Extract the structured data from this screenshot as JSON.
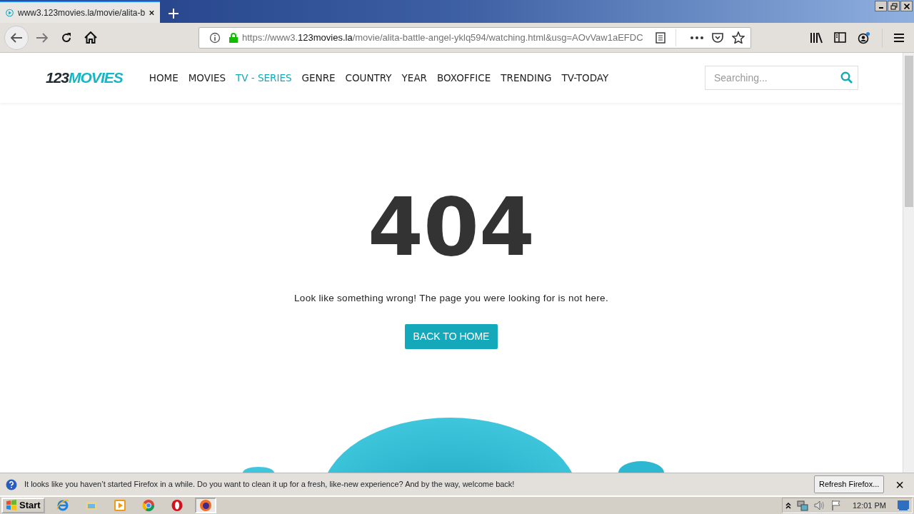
{
  "browser": {
    "tabs": [
      {
        "title": "www3.123movies.la/movie/alita-b",
        "selected": true
      }
    ],
    "url": {
      "scheme": "https://www3.",
      "domain": "123movies.la",
      "path": "/movie/alita-battle-angel-yklq594/watching.html&usg=AOvVaw1aEFDC"
    }
  },
  "site": {
    "logo": {
      "digits": "123",
      "word": "MOVIES"
    },
    "nav": [
      {
        "label": "HOME",
        "selected": false
      },
      {
        "label": "MOVIES",
        "selected": false
      },
      {
        "label": "TV - SERIES",
        "selected": true
      },
      {
        "label": "GENRE",
        "selected": false
      },
      {
        "label": "COUNTRY",
        "selected": false
      },
      {
        "label": "YEAR",
        "selected": false
      },
      {
        "label": "BOXOFFICE",
        "selected": false
      },
      {
        "label": "TRENDING",
        "selected": false
      },
      {
        "label": "TV-TODAY",
        "selected": false
      }
    ],
    "search": {
      "placeholder": "Searching..."
    },
    "error": {
      "code": "404",
      "message": "Look like something wrong! The page you were looking for is not here.",
      "button": "BACK TO HOME"
    }
  },
  "notification": {
    "text": "It looks like you haven’t started Firefox in a while. Do you want to clean it up for a fresh, like-new experience? And by the way, welcome back!",
    "button": "Refresh Firefox...",
    "close": "×"
  },
  "taskbar": {
    "start": "Start",
    "apps": [
      {
        "kind": "ie",
        "selected": false
      },
      {
        "kind": "explorer",
        "selected": false
      },
      {
        "kind": "media",
        "selected": false
      },
      {
        "kind": "chrome",
        "selected": false
      },
      {
        "kind": "opera",
        "selected": false
      },
      {
        "kind": "firefox",
        "selected": true
      }
    ],
    "clock": "12:01 PM"
  }
}
